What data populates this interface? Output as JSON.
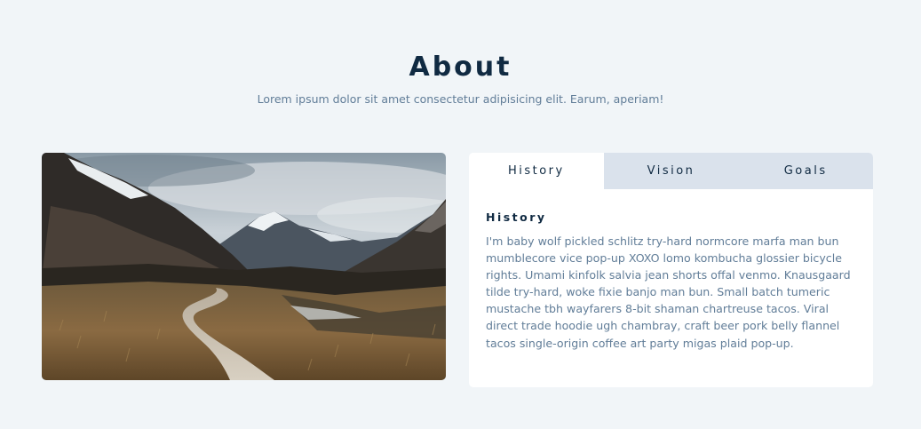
{
  "section": {
    "title": "About",
    "subtitle": "Lorem ipsum dolor sit amet consectetur adipisicing elit. Earum, aperiam!"
  },
  "photo": {
    "description_icon": "mountain-landscape-image"
  },
  "tabs": [
    {
      "label": "History",
      "active": true
    },
    {
      "label": "Vision",
      "active": false
    },
    {
      "label": "Goals",
      "active": false
    }
  ],
  "content": {
    "heading": "History",
    "text": "I'm baby wolf pickled schlitz try-hard normcore marfa man bun mumblecore vice pop-up XOXO lomo kombucha glossier bicycle rights. Umami kinfolk salvia jean shorts offal venmo. Knausgaard tilde try-hard, woke fixie banjo man bun. Small batch tumeric mustache tbh wayfarers 8-bit shaman chartreuse tacos. Viral direct trade hoodie ugh chambray, craft beer pork belly flannel tacos single-origin coffee art party migas plaid pop-up."
  },
  "colors": {
    "background": "#f1f5f8",
    "title": "#102a42",
    "text": "#617d98",
    "tab_inactive": "#dae2ec",
    "card": "#ffffff"
  }
}
